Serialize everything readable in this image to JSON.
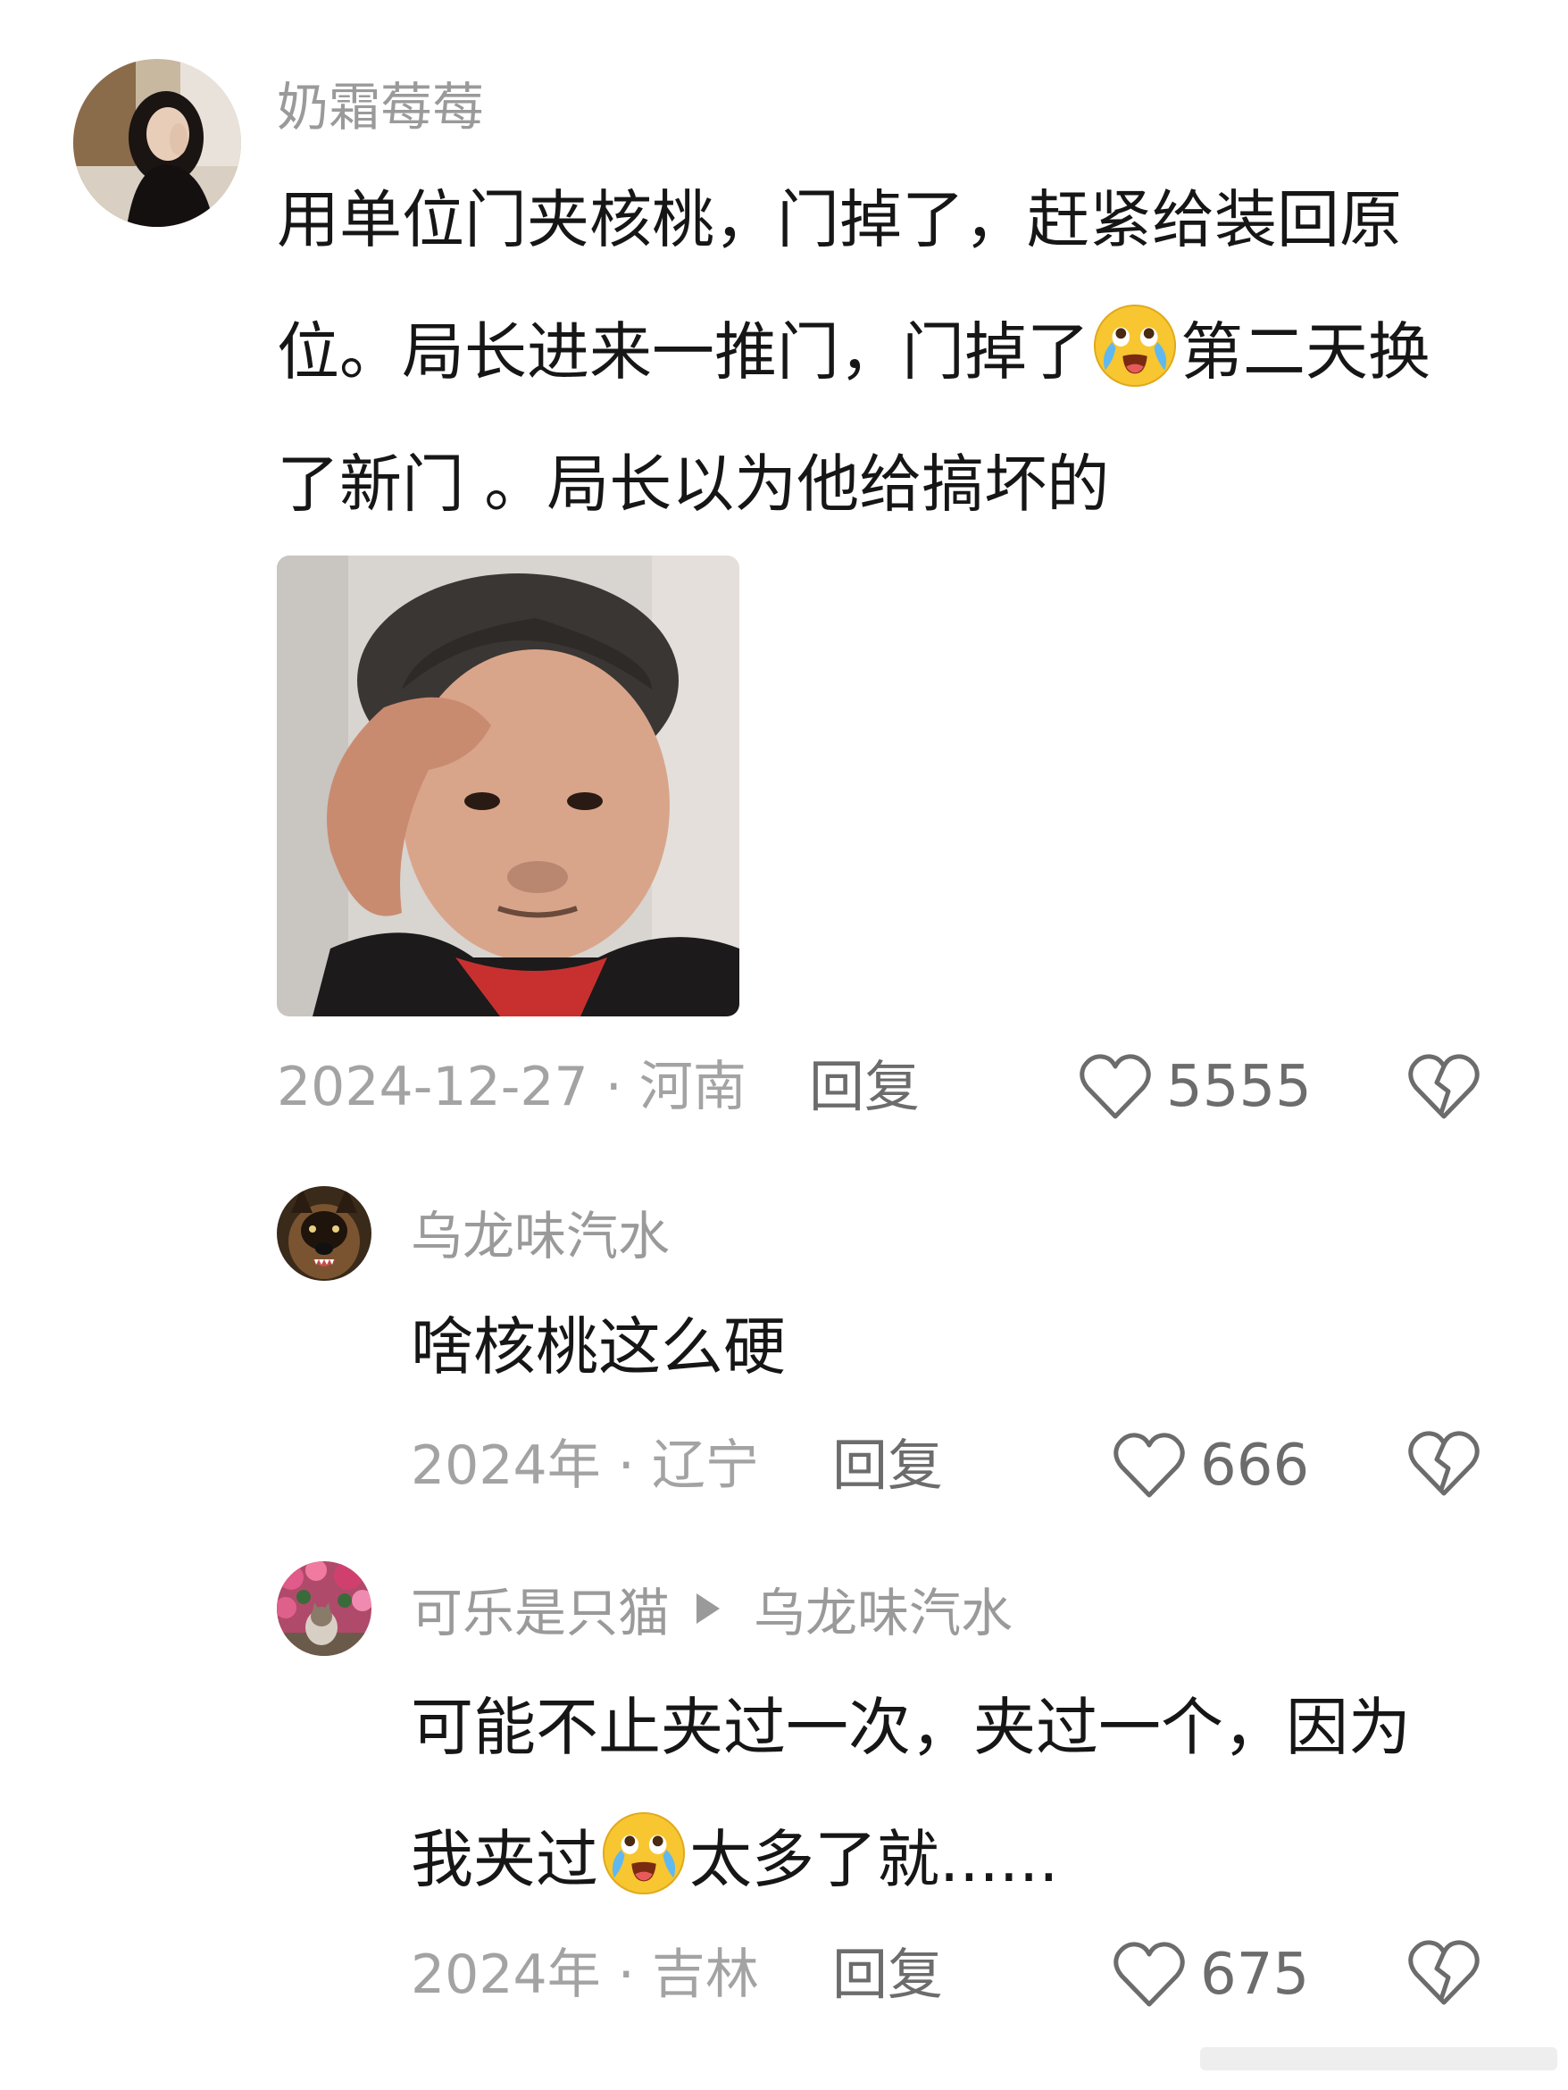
{
  "comments": [
    {
      "username": "奶霜莓莓",
      "text_lines": [
        "用单位门夹核桃，门掉了，赶紧给装回原",
        "位。局长进来一推门，门掉了",
        "第二天换",
        "了新门 。局长以为他给搞坏的"
      ],
      "emoji_1": "crying-laughing-emoji",
      "date": "2024-12-27",
      "separator": " · ",
      "location": "河南",
      "reply_label": "回复",
      "likes": "5555"
    },
    {
      "username": "乌龙味汽水",
      "text_lines": [
        "啥核桃这么硬"
      ],
      "date": "2024年",
      "separator": " · ",
      "location": "辽宁",
      "reply_label": "回复",
      "likes": "666"
    },
    {
      "username": "可乐是只猫",
      "reply_to": "乌龙味汽水",
      "text_lines": [
        "可能不止夹过一次，夹过一个，因为",
        "我夹过",
        "太多了就......"
      ],
      "emoji_1": "crying-laughing-emoji",
      "date": "2024年",
      "separator": " · ",
      "location": "吉林",
      "reply_label": "回复",
      "likes": "675"
    }
  ],
  "icons": {
    "like": "heart-outline-icon",
    "dislike": "broken-heart-icon",
    "reply_arrow": "play-triangle-icon"
  },
  "colors": {
    "username": "#9a9a9a",
    "body_text": "#161616",
    "meta": "#a3a3a3",
    "action": "#6c6c6c",
    "emoji_face": "#f7c631"
  }
}
